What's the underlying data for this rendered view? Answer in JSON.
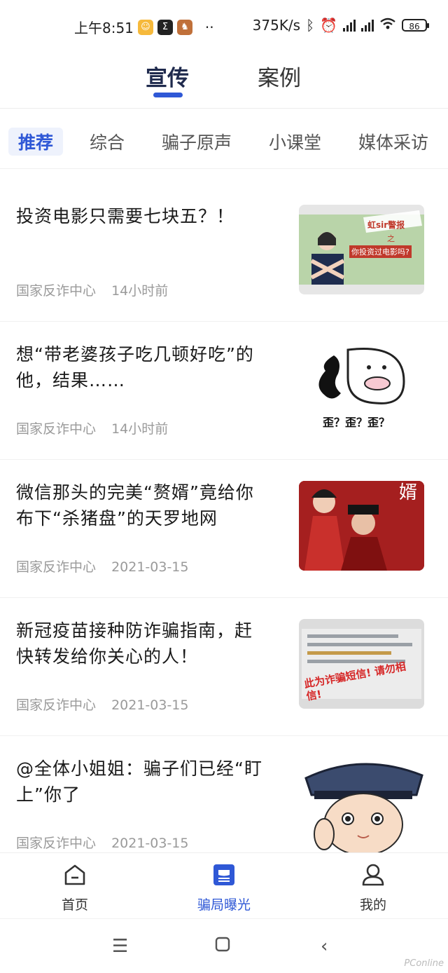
{
  "status_bar": {
    "time": "上午8:51",
    "speed": "375K/s",
    "battery": "86",
    "more": "··"
  },
  "main_tabs": [
    {
      "label": "宣传",
      "active": true
    },
    {
      "label": "案例",
      "active": false
    }
  ],
  "category_tabs": [
    {
      "label": "推荐",
      "active": true
    },
    {
      "label": "综合",
      "active": false
    },
    {
      "label": "骗子原声",
      "active": false
    },
    {
      "label": "小课堂",
      "active": false
    },
    {
      "label": "媒体采访",
      "active": false
    }
  ],
  "articles": [
    {
      "title": "投资电影只需要七块五？！",
      "source": "国家反诈中心",
      "time": "14小时前",
      "thumb": {
        "line1": "虹sir警报",
        "line2": "之",
        "line3": "你投资过电影吗?"
      }
    },
    {
      "title": "想“带老婆孩子吃几顿好吃”的他，结果……",
      "source": "国家反诈中心",
      "time": "14小时前",
      "thumb": {
        "caption": "歪？歪？歪？"
      }
    },
    {
      "title": "微信那头的完美“赘婿”竟给你布下“杀猪盘”的天罗地网",
      "source": "国家反诈中心",
      "time": "2021-03-15",
      "thumb": {
        "mark": "婿"
      }
    },
    {
      "title": "新冠疫苗接种防诈骗指南，赶快转发给你关心的人！",
      "source": "国家反诈中心",
      "time": "2021-03-15",
      "thumb": {
        "stamp": "此为诈骗短信! 请勿相信!"
      }
    },
    {
      "title": "@全体小姐姐：骗子们已经“盯上”你了",
      "source": "国家反诈中心",
      "time": "2021-03-15",
      "thumb": {}
    }
  ],
  "bottom_nav": [
    {
      "label": "首页",
      "icon": "home-icon",
      "active": false
    },
    {
      "label": "骗局曝光",
      "icon": "exposure-icon",
      "active": true
    },
    {
      "label": "我的",
      "icon": "profile-icon",
      "active": false
    }
  ],
  "watermark": "PConline",
  "colors": {
    "accent": "#2f58d6",
    "text": "#1a1a1a",
    "meta": "#9a9a9a"
  }
}
